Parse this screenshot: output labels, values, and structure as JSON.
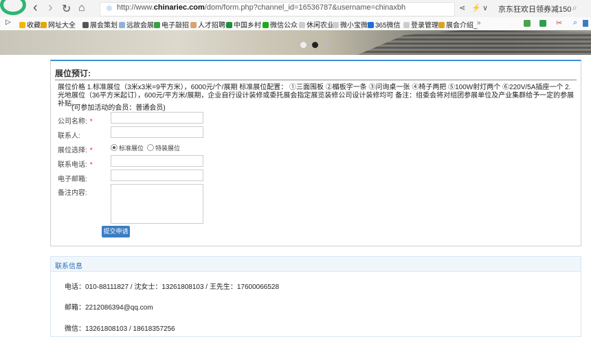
{
  "browser": {
    "url_prefix": "http://www.",
    "url_domain": "chinariec.com",
    "url_rest": "/dom/form.php?channel_id=16536787&username=chinaxbh",
    "promo": "京东狂欢日领券减150",
    "back_glyph": "‹",
    "forward_glyph": "›",
    "reload_glyph": "↻",
    "home_glyph": "⌂",
    "share_glyph": "⋖",
    "lightning_glyph": "⚡",
    "dropdown_glyph": "∨",
    "search_glyph": "⌕"
  },
  "bookmarks": [
    {
      "label": "收藏",
      "icon": "star-icon",
      "color": "#f2b705"
    },
    {
      "label": "网址大全",
      "icon": "globe-icon",
      "color": "#e6a700"
    },
    {
      "label": "展会策划",
      "icon": "folder-icon",
      "color": "#555555"
    },
    {
      "label": "远故会展",
      "icon": "page-icon",
      "color": "#8fb0d8"
    },
    {
      "label": "电子敲招",
      "icon": "check-icon",
      "color": "#36a13f"
    },
    {
      "label": "人才招聘-",
      "icon": "hand-icon",
      "color": "#d5a66b"
    },
    {
      "label": "中国乡村",
      "icon": "star-icon",
      "color": "#1e8f3a"
    },
    {
      "label": "微信公众",
      "icon": "wechat-icon",
      "color": "#1aad19"
    },
    {
      "label": "休闲农业",
      "icon": "page-icon",
      "color": "#cccccc"
    },
    {
      "label": "微小宝微",
      "icon": "page-icon",
      "color": "#cccccc"
    },
    {
      "label": "365微信",
      "icon": "bottle-icon",
      "color": "#1e6fd8"
    },
    {
      "label": "登录管理",
      "icon": "page-icon",
      "color": "#cccccc"
    },
    {
      "label": "展会介绍_",
      "icon": "asterisk-icon",
      "color": "#e0a020"
    }
  ],
  "bookmark_more": "»",
  "form": {
    "title": "展位预订:",
    "description": "展位价格 1.标准展位（3米x3米=9平方米），6000元/个/展期 标准展位配置： ①三面围板 ②楣板字一条 ③问询桌一张 ④椅子两把 ⑤100W射灯两个 ⑥220V/5A插座一个 2.光地展位（36平方米起订），600元/平方米/展期，企业自行设计装修或委托展会指定展览装修公司设计装修均可 备注：组委会将对组团参展单位及产业集群给予一定的参展补贴。",
    "member_note": "(可参加活动的会员：普通会员)",
    "company_label": "公司名称:",
    "contact_label": "联系人:",
    "booth_label": "展位选择:",
    "booth_option_1": "标准展位",
    "booth_option_2": "特装展位",
    "phone_label": "联系电话:",
    "email_label": "电子邮箱:",
    "remark_label": "备注内容:",
    "required_mark": "*",
    "submit": "提交申请"
  },
  "contact": {
    "title": "联系信息",
    "phone_line": "电话：010-88111827 / 沈女士：13261808103 / 王先生：17600066528",
    "email_line": "邮箱：2212086394@qq.com",
    "wechat_line": "微信：13261808103 / 18618357256"
  }
}
